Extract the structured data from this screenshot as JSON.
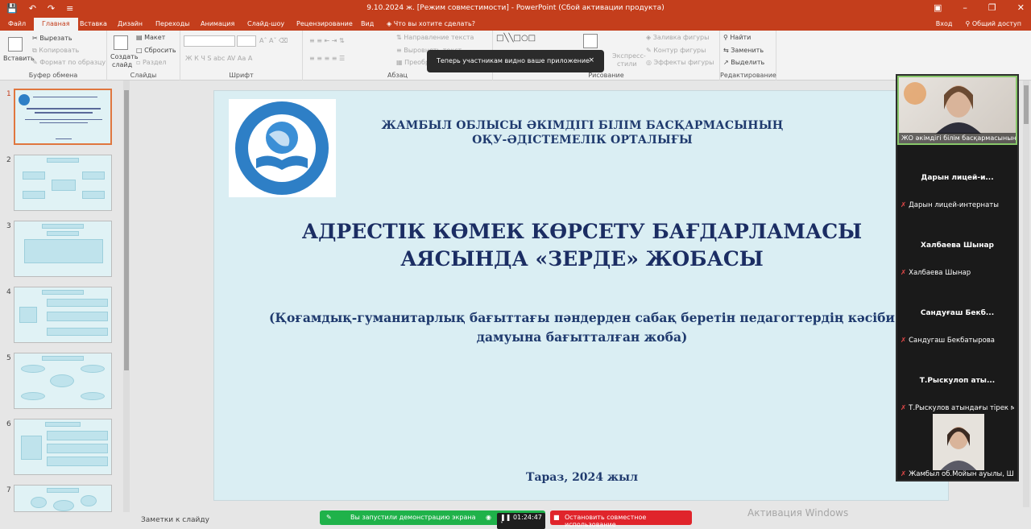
{
  "titlebar": {
    "doc_title": "9.10.2024 ж. [Режим совместимости] - PowerPoint (Сбой активации продукта)"
  },
  "menu": {
    "tabs": [
      "Файл",
      "Главная",
      "Вставка",
      "Дизайн",
      "Переходы",
      "Анимация",
      "Слайд-шоу",
      "Рецензирование",
      "Вид"
    ],
    "tellme": "Что вы хотите сделать?",
    "signin": "Вход",
    "share": "Общий доступ"
  },
  "ribbon": {
    "paste": "Вставить",
    "cut": "Вырезать",
    "copy": "Копировать",
    "format_painter": "Формат по образцу",
    "clipboard_group": "Буфер обмена",
    "layout": "Макет",
    "reset": "Сбросить",
    "section": "Раздел",
    "new_slide": "Создать",
    "new_slide2": "слайд",
    "slides_group": "Слайды",
    "font_group": "Шрифт",
    "text_direction": "Направление текста",
    "align_text": "Выровнять текст",
    "convert": "Преобр",
    "paragraph_group": "Абзац",
    "express": "Экспресс-",
    "styles": "стили",
    "shape_fill": "Заливка фигуры",
    "shape_outline": "Контур фигуры",
    "shape_effects": "Эффекты фигуры",
    "drawing_group": "Рисование",
    "find": "Найти",
    "replace": "Заменить",
    "select": "Выделить",
    "editing_group": "Редактирование"
  },
  "notification": {
    "text": "Теперь участникам видно ваше приложение",
    "close": "×"
  },
  "thumbnails": {
    "numbers": [
      "1",
      "2",
      "3",
      "4",
      "5",
      "6",
      "7"
    ]
  },
  "slide": {
    "org_line1": "ЖАМБЫЛ ОБЛЫСЫ ӘКІМДІГІ БІЛІМ БАСҚАРМАСЫНЫҢ",
    "org_line2": "ОҚУ-ӘДІСТЕМЕЛІК ОРТАЛЫҒЫ",
    "title_line1": "АДРЕСТІК КӨМЕК КӨРСЕТУ БАҒДАРЛАМАСЫ",
    "title_line2": "АЯСЫНДА «ЗЕРДЕ» ЖОБАСЫ",
    "subtitle_line1": "(Қоғамдық-гуманитарлық бағыттағы пәндерден сабақ беретін педагогтердің кәсіби",
    "subtitle_line2": "дамуына бағытталған жоба)",
    "footer": "Тараз,  2024 жыл"
  },
  "participants": {
    "active_label": "ЖО әкімдігі білім басқармасының",
    "tiles": [
      {
        "name": "Дарын  лицей-и...",
        "label": "Дарын лицей-интернаты"
      },
      {
        "name": "Халбаева Шынар",
        "label": "Халбаева Шынар"
      },
      {
        "name": "Сандуғаш  Бекб...",
        "label": "Сандугаш Бекбатырова"
      },
      {
        "name": "Т.Рыскулоп  аты...",
        "label": "Т.Рыскулов атындағы тірек мект..."
      }
    ],
    "last_label": "Жамбыл об.Мойын ауылы, Шы..."
  },
  "statusbar": {
    "notes": "Заметки к слайду",
    "sharing": "Вы запустили демонстрацию экрана",
    "timer": "01:24:47",
    "stop": "Остановить совместное использование",
    "activation": "Активация Windows"
  },
  "colors": {
    "accent": "#c43e1c",
    "slide_bg": "#daeef3",
    "title_color": "#1b2d63",
    "share_green": "#1fb24a",
    "share_red": "#e0242b"
  }
}
